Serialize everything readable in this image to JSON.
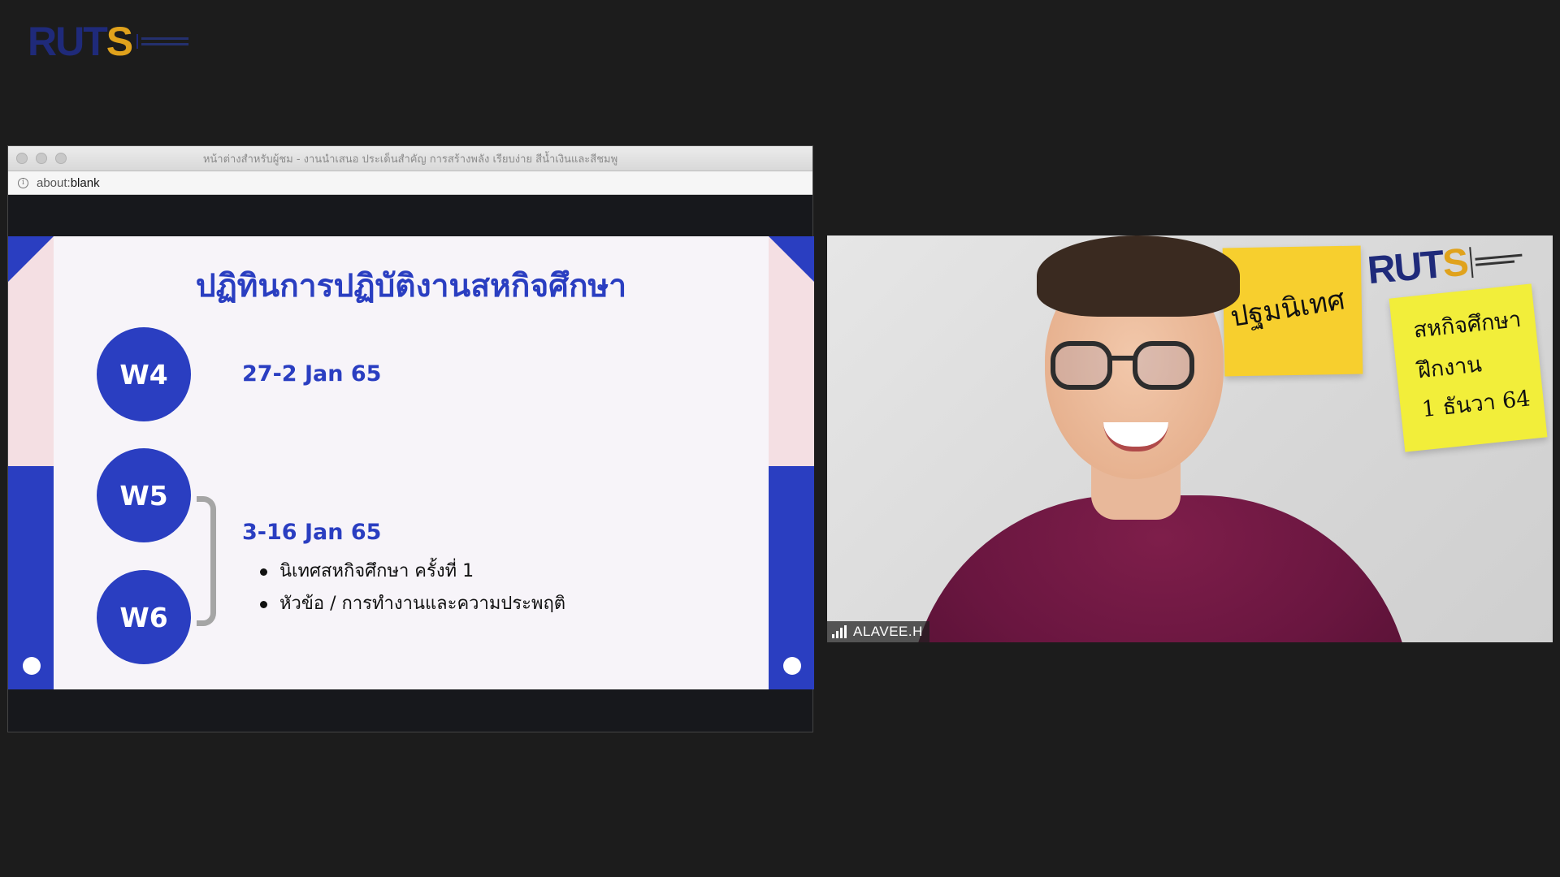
{
  "brand": {
    "logo_part1": "RUT",
    "logo_part2": "S",
    "colors": {
      "navy": "#1f2a7a",
      "gold": "#e0a21c",
      "slide_blue": "#2a3ec1",
      "slide_pink": "#f4dfe3"
    }
  },
  "share_window": {
    "title": "หน้าต่างสำหรับผู้ชม - งานนำเสนอ ประเด็นสำคัญ การสร้างพลัง เรียบง่าย สีน้ำเงินและสีชมพู",
    "address_prefix": "about:",
    "address_suffix": "blank",
    "icons": {
      "info": "info-icon"
    }
  },
  "slide": {
    "title": "ปฏิทินการปฏิบัติงานสหกิจศึกษา",
    "weeks": [
      "W4",
      "W5",
      "W6"
    ],
    "w4_date": "27-2 Jan 65",
    "w5_w6_date": "3-16 Jan 65",
    "bullets": [
      "นิเทศสหกิจศึกษา ครั้งที่ 1",
      "หัวข้อ / การทำงานและความประพฤติ"
    ]
  },
  "video": {
    "participant_name": "ALAVEE.H",
    "icons": {
      "signal": "signal-strength-icon"
    },
    "notes": {
      "orange": "ปฐมนิเทศ",
      "yellow": [
        "สหกิจศึกษา",
        "ฝึกงาน",
        "1 ธันวา 64"
      ]
    }
  }
}
